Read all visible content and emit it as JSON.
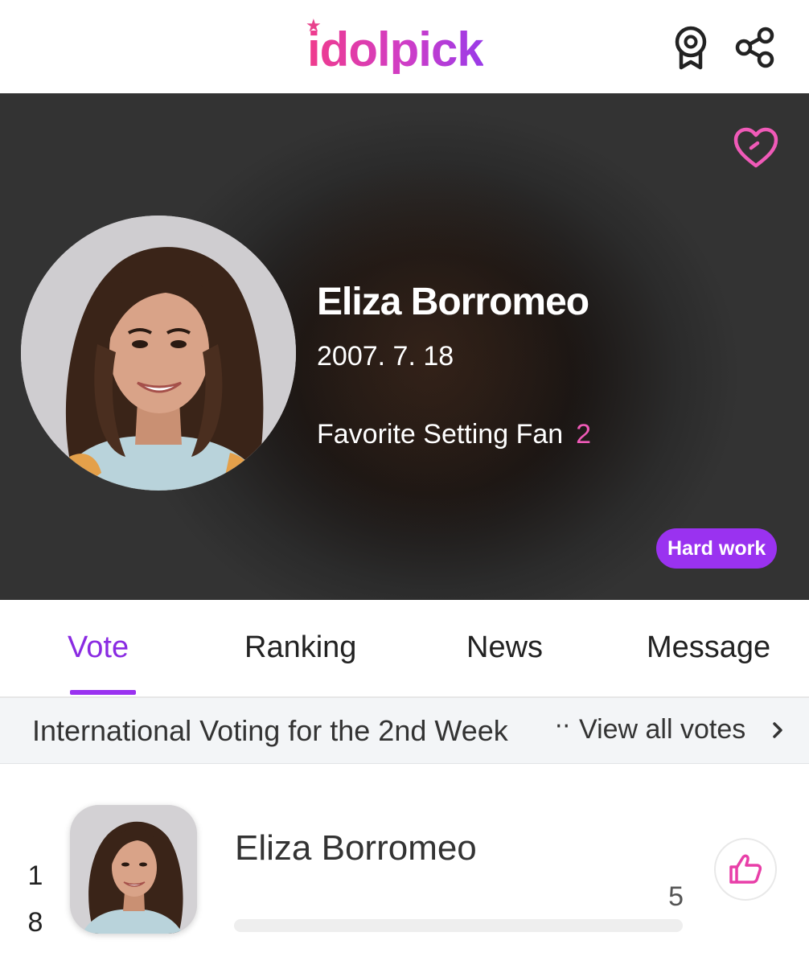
{
  "header": {
    "logo_text": "idolpick",
    "icons": {
      "award": "award-badge-icon",
      "share": "share-icon"
    }
  },
  "profile": {
    "name": "Eliza Borromeo",
    "birthdate": "2007. 7. 18",
    "fan_label": "Favorite Setting Fan",
    "fan_count": "2",
    "badge": "Hard work",
    "favorite_icon": "heart-outline-icon"
  },
  "tabs": [
    {
      "label": "Vote",
      "active": true
    },
    {
      "label": "Ranking",
      "active": false
    },
    {
      "label": "News",
      "active": false
    },
    {
      "label": "Message",
      "active": false
    }
  ],
  "vote_section": {
    "title": "International Voting for the 2nd Week",
    "view_all_label": "View all votes"
  },
  "vote_list": [
    {
      "rank": "1\n8",
      "rank_digits": [
        "1",
        "8"
      ],
      "name": "Eliza Borromeo",
      "votes": "5",
      "progress": 0.0,
      "like_icon": "thumbs-up-icon"
    }
  ],
  "colors": {
    "brand_pink": "#f03c8c",
    "brand_purple": "#9a32f0",
    "active_tab": "#8a2be2",
    "fan_count": "#f05ab8"
  }
}
